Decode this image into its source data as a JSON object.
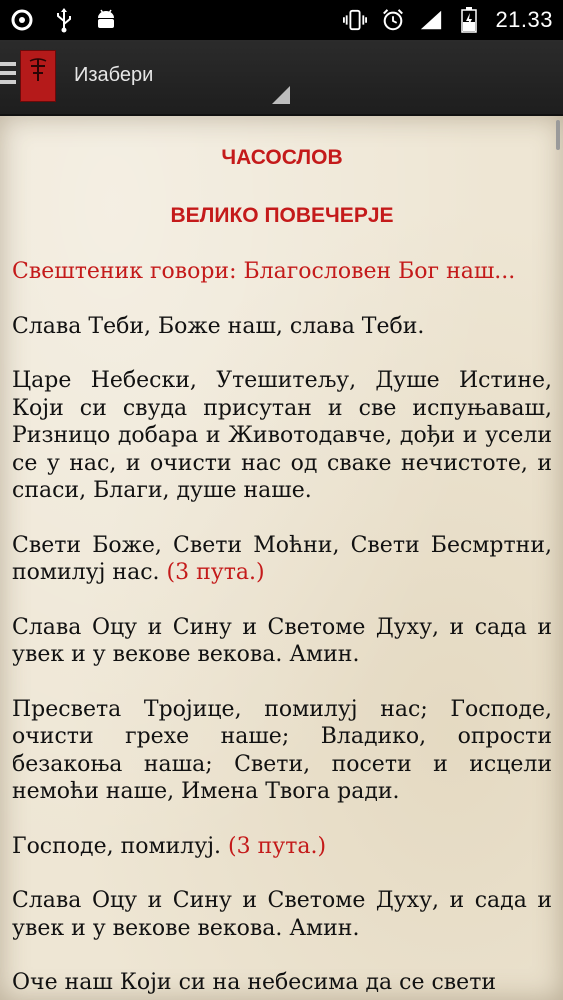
{
  "status_bar": {
    "time": "21.33",
    "icons": [
      "circle-app-icon",
      "usb-icon",
      "android-icon",
      "vibrate-icon",
      "alarm-icon",
      "signal-icon",
      "battery-icon"
    ]
  },
  "action_bar": {
    "spinner_label": "Изабери"
  },
  "content": {
    "title": "ЧАСОСЛОВ",
    "subtitle": "ВЕЛИКО ПОВЕЧЕРЈЕ",
    "rubric": "Свештеник говори: Благословен Бог наш...",
    "p1": "Слава Теби, Боже наш, слава Теби.",
    "p2": "Царе Небески, Утешитељу, Душе Истине, Који си свуда присутан и све испуњаваш, Ризницо добара и Животодавче, дођи и усели се у нас, и очисти нас од сваке нечистоте, и спаси, Благи, душе наше.",
    "p3": "Свети Боже, Свети Моћни, Свети Бесмртни, помилуј нас.",
    "p3_note": "(3 пута.)",
    "p4": "Слава Оцу и Сину и Светоме Духу, и сада и увек и у векове векова. Амин.",
    "p5": "Пресвета Тројице, помилуј нас; Господе, очисти грехе наше; Владико, опрости безакоња наша; Свети, посети и исцели немоћи наше, Имена Твога ради.",
    "p6": "Господе, помилуј.",
    "p6_note": "(3 пута.)",
    "p7": "Слава Оцу и Сину и Светоме Духу, и сада и увек и у векове векова. Амин.",
    "p8": "Оче наш Који си на небесима да се свети"
  }
}
